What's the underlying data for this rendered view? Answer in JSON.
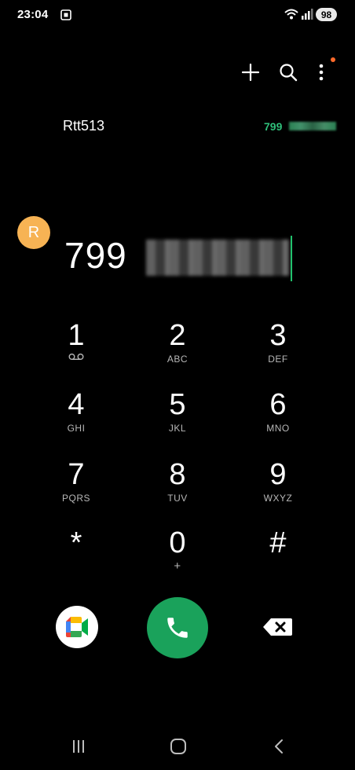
{
  "status_bar": {
    "time": "23:04",
    "battery": "98"
  },
  "suggestion": {
    "avatar_letter": "R",
    "name": "Rtt513",
    "number_prefix": "799"
  },
  "dialer": {
    "number_prefix": "799"
  },
  "keypad": [
    {
      "digit": "1",
      "sub": ""
    },
    {
      "digit": "2",
      "sub": "ABC"
    },
    {
      "digit": "3",
      "sub": "DEF"
    },
    {
      "digit": "4",
      "sub": "GHI"
    },
    {
      "digit": "5",
      "sub": "JKL"
    },
    {
      "digit": "6",
      "sub": "MNO"
    },
    {
      "digit": "7",
      "sub": "PQRS"
    },
    {
      "digit": "8",
      "sub": "TUV"
    },
    {
      "digit": "9",
      "sub": "WXYZ"
    },
    {
      "digit": "*",
      "sub": ""
    },
    {
      "digit": "0",
      "sub": "+"
    },
    {
      "digit": "#",
      "sub": ""
    }
  ],
  "icons": {
    "add": "plus-icon",
    "search": "search-icon",
    "more": "more-vert-icon",
    "voicemail": "voicemail-icon",
    "meet": "google-meet-icon",
    "call": "phone-icon",
    "delete": "backspace-icon"
  },
  "colors": {
    "background": "#000000",
    "accent_green": "#1aa25b",
    "match_green": "#2fbf7a",
    "avatar": "#f7b354",
    "notification_dot": "#ff6a2b"
  }
}
